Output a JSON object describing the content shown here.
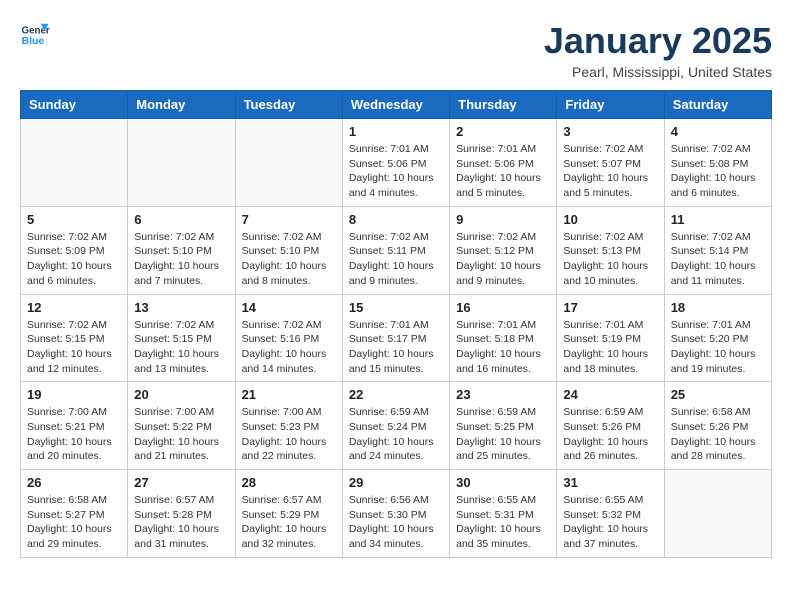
{
  "logo": {
    "line1": "General",
    "line2": "Blue"
  },
  "title": "January 2025",
  "subtitle": "Pearl, Mississippi, United States",
  "weekdays": [
    "Sunday",
    "Monday",
    "Tuesday",
    "Wednesday",
    "Thursday",
    "Friday",
    "Saturday"
  ],
  "weeks": [
    [
      {
        "day": "",
        "info": ""
      },
      {
        "day": "",
        "info": ""
      },
      {
        "day": "",
        "info": ""
      },
      {
        "day": "1",
        "info": "Sunrise: 7:01 AM\nSunset: 5:06 PM\nDaylight: 10 hours\nand 4 minutes."
      },
      {
        "day": "2",
        "info": "Sunrise: 7:01 AM\nSunset: 5:06 PM\nDaylight: 10 hours\nand 5 minutes."
      },
      {
        "day": "3",
        "info": "Sunrise: 7:02 AM\nSunset: 5:07 PM\nDaylight: 10 hours\nand 5 minutes."
      },
      {
        "day": "4",
        "info": "Sunrise: 7:02 AM\nSunset: 5:08 PM\nDaylight: 10 hours\nand 6 minutes."
      }
    ],
    [
      {
        "day": "5",
        "info": "Sunrise: 7:02 AM\nSunset: 5:09 PM\nDaylight: 10 hours\nand 6 minutes."
      },
      {
        "day": "6",
        "info": "Sunrise: 7:02 AM\nSunset: 5:10 PM\nDaylight: 10 hours\nand 7 minutes."
      },
      {
        "day": "7",
        "info": "Sunrise: 7:02 AM\nSunset: 5:10 PM\nDaylight: 10 hours\nand 8 minutes."
      },
      {
        "day": "8",
        "info": "Sunrise: 7:02 AM\nSunset: 5:11 PM\nDaylight: 10 hours\nand 9 minutes."
      },
      {
        "day": "9",
        "info": "Sunrise: 7:02 AM\nSunset: 5:12 PM\nDaylight: 10 hours\nand 9 minutes."
      },
      {
        "day": "10",
        "info": "Sunrise: 7:02 AM\nSunset: 5:13 PM\nDaylight: 10 hours\nand 10 minutes."
      },
      {
        "day": "11",
        "info": "Sunrise: 7:02 AM\nSunset: 5:14 PM\nDaylight: 10 hours\nand 11 minutes."
      }
    ],
    [
      {
        "day": "12",
        "info": "Sunrise: 7:02 AM\nSunset: 5:15 PM\nDaylight: 10 hours\nand 12 minutes."
      },
      {
        "day": "13",
        "info": "Sunrise: 7:02 AM\nSunset: 5:15 PM\nDaylight: 10 hours\nand 13 minutes."
      },
      {
        "day": "14",
        "info": "Sunrise: 7:02 AM\nSunset: 5:16 PM\nDaylight: 10 hours\nand 14 minutes."
      },
      {
        "day": "15",
        "info": "Sunrise: 7:01 AM\nSunset: 5:17 PM\nDaylight: 10 hours\nand 15 minutes."
      },
      {
        "day": "16",
        "info": "Sunrise: 7:01 AM\nSunset: 5:18 PM\nDaylight: 10 hours\nand 16 minutes."
      },
      {
        "day": "17",
        "info": "Sunrise: 7:01 AM\nSunset: 5:19 PM\nDaylight: 10 hours\nand 18 minutes."
      },
      {
        "day": "18",
        "info": "Sunrise: 7:01 AM\nSunset: 5:20 PM\nDaylight: 10 hours\nand 19 minutes."
      }
    ],
    [
      {
        "day": "19",
        "info": "Sunrise: 7:00 AM\nSunset: 5:21 PM\nDaylight: 10 hours\nand 20 minutes."
      },
      {
        "day": "20",
        "info": "Sunrise: 7:00 AM\nSunset: 5:22 PM\nDaylight: 10 hours\nand 21 minutes."
      },
      {
        "day": "21",
        "info": "Sunrise: 7:00 AM\nSunset: 5:23 PM\nDaylight: 10 hours\nand 22 minutes."
      },
      {
        "day": "22",
        "info": "Sunrise: 6:59 AM\nSunset: 5:24 PM\nDaylight: 10 hours\nand 24 minutes."
      },
      {
        "day": "23",
        "info": "Sunrise: 6:59 AM\nSunset: 5:25 PM\nDaylight: 10 hours\nand 25 minutes."
      },
      {
        "day": "24",
        "info": "Sunrise: 6:59 AM\nSunset: 5:26 PM\nDaylight: 10 hours\nand 26 minutes."
      },
      {
        "day": "25",
        "info": "Sunrise: 6:58 AM\nSunset: 5:26 PM\nDaylight: 10 hours\nand 28 minutes."
      }
    ],
    [
      {
        "day": "26",
        "info": "Sunrise: 6:58 AM\nSunset: 5:27 PM\nDaylight: 10 hours\nand 29 minutes."
      },
      {
        "day": "27",
        "info": "Sunrise: 6:57 AM\nSunset: 5:28 PM\nDaylight: 10 hours\nand 31 minutes."
      },
      {
        "day": "28",
        "info": "Sunrise: 6:57 AM\nSunset: 5:29 PM\nDaylight: 10 hours\nand 32 minutes."
      },
      {
        "day": "29",
        "info": "Sunrise: 6:56 AM\nSunset: 5:30 PM\nDaylight: 10 hours\nand 34 minutes."
      },
      {
        "day": "30",
        "info": "Sunrise: 6:55 AM\nSunset: 5:31 PM\nDaylight: 10 hours\nand 35 minutes."
      },
      {
        "day": "31",
        "info": "Sunrise: 6:55 AM\nSunset: 5:32 PM\nDaylight: 10 hours\nand 37 minutes."
      },
      {
        "day": "",
        "info": ""
      }
    ]
  ]
}
